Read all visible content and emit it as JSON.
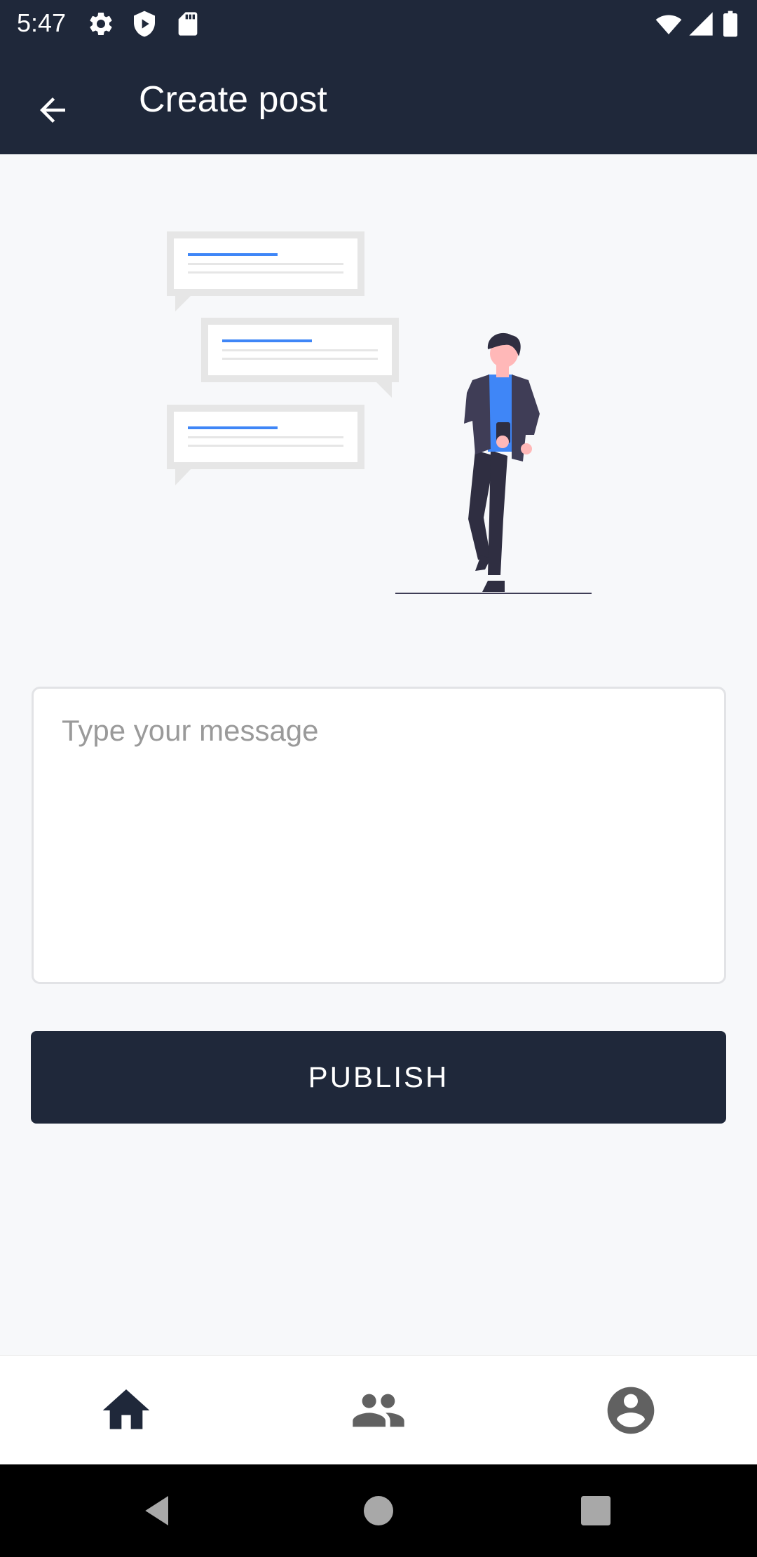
{
  "status_bar": {
    "time": "5:47",
    "left_icons": [
      "settings-icon",
      "shield-icon",
      "sd-card-icon"
    ],
    "right_icons": [
      "wifi-icon",
      "cellular-signal-icon",
      "battery-icon"
    ]
  },
  "app_bar": {
    "back_icon": "arrow-left-icon",
    "title": "Create post"
  },
  "illustration": {
    "name": "messages-person-illustration"
  },
  "message": {
    "placeholder": "Type your message",
    "value": ""
  },
  "publish": {
    "label": "PUBLISH"
  },
  "bottom_nav": {
    "items": [
      {
        "icon": "home-icon",
        "active": true
      },
      {
        "icon": "group-icon",
        "active": false
      },
      {
        "icon": "account-circle-icon",
        "active": false
      }
    ]
  },
  "system_nav": {
    "items": [
      "back-triangle-icon",
      "home-circle-icon",
      "recents-square-icon"
    ]
  },
  "colors": {
    "primary": "#1f283a",
    "background": "#f7f8fa",
    "accent_blue": "#3f86f7",
    "icon_gray": "#616161"
  }
}
